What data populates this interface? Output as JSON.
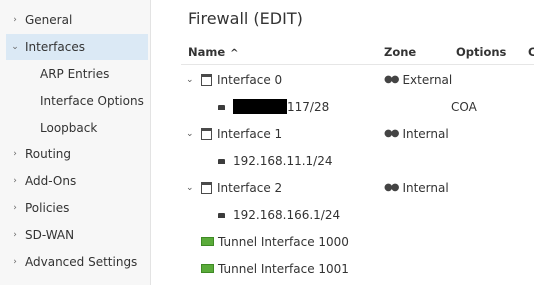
{
  "sidebar": {
    "items": [
      {
        "label": "General",
        "caret": "›"
      },
      {
        "label": "Interfaces",
        "caret": "⌄"
      },
      {
        "label": "Routing",
        "caret": "›"
      },
      {
        "label": "Add-Ons",
        "caret": "›"
      },
      {
        "label": "Policies",
        "caret": "›"
      },
      {
        "label": "SD-WAN",
        "caret": "›"
      },
      {
        "label": "Advanced Settings",
        "caret": "›"
      }
    ],
    "subitems": [
      {
        "label": "ARP Entries"
      },
      {
        "label": "Interface Options"
      },
      {
        "label": "Loopback"
      }
    ]
  },
  "page": {
    "title": "Firewall (EDIT)"
  },
  "table": {
    "columns": {
      "name": "Name",
      "sort_icon": "^",
      "zone": "Zone",
      "options": "Options",
      "next": "C"
    },
    "rows": [
      {
        "type": "interface",
        "name": "Interface 0",
        "zone": "External",
        "expander": "⌄",
        "zone_icon": "people-icon"
      },
      {
        "type": "address",
        "name": "117/28",
        "options": "COA",
        "redacted": true
      },
      {
        "type": "interface",
        "name": "Interface 1",
        "zone": "Internal",
        "expander": "⌄",
        "zone_icon": "people-icon"
      },
      {
        "type": "address",
        "name": "192.168.11.1/24"
      },
      {
        "type": "interface",
        "name": "Interface 2",
        "zone": "Internal",
        "expander": "⌄",
        "zone_icon": "people-icon"
      },
      {
        "type": "address",
        "name": "192.168.166.1/24"
      },
      {
        "type": "tunnel",
        "name": "Tunnel Interface 1000"
      },
      {
        "type": "tunnel",
        "name": "Tunnel Interface 1001"
      }
    ]
  },
  "colors": {
    "active_nav": "#dbe9f5",
    "sidebar_bg": "#f7f7f7",
    "tunnel_green": "#5aab3a"
  }
}
